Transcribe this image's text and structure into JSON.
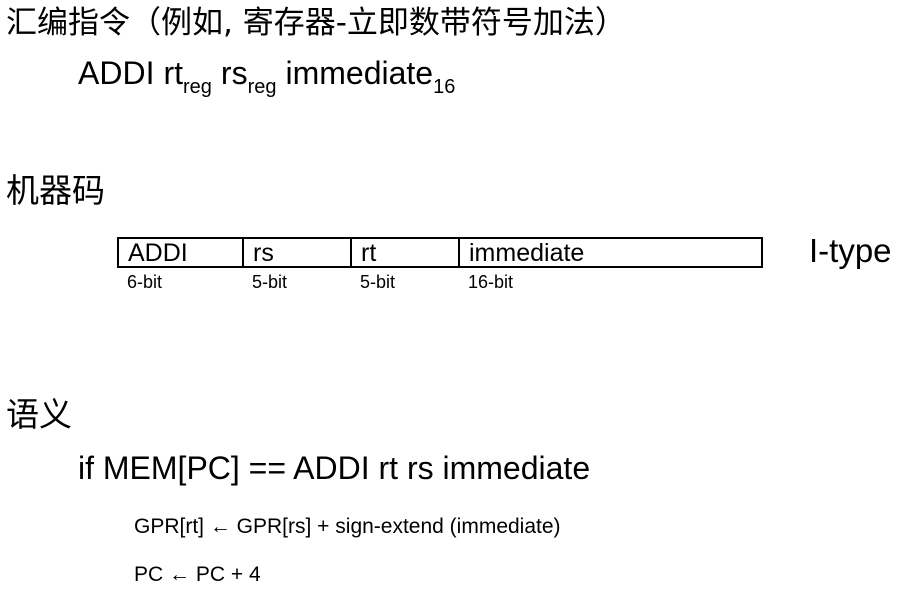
{
  "headings": {
    "assembly": "汇编指令（例如, 寄存器-立即数带符号加法）",
    "machine_code": "机器码",
    "semantics": "语义"
  },
  "syntax": {
    "mnemonic": "ADDI",
    "rt": "rt",
    "rt_sub": "reg",
    "rs": "rs",
    "rs_sub": "reg",
    "imm": "immediate",
    "imm_sub": "16"
  },
  "machine_code": {
    "fields": [
      {
        "name": "ADDI",
        "bits": "6-bit"
      },
      {
        "name": "rs",
        "bits": "5-bit"
      },
      {
        "name": "rt",
        "bits": "5-bit"
      },
      {
        "name": "immediate",
        "bits": "16-bit"
      }
    ],
    "type_label": "I-type"
  },
  "semantics": {
    "condition": "if MEM[PC] == ADDI rt rs immediate",
    "lines": [
      "GPR[rt] ← GPR[rs] + sign-extend (immediate)",
      "PC ← PC + 4"
    ]
  }
}
